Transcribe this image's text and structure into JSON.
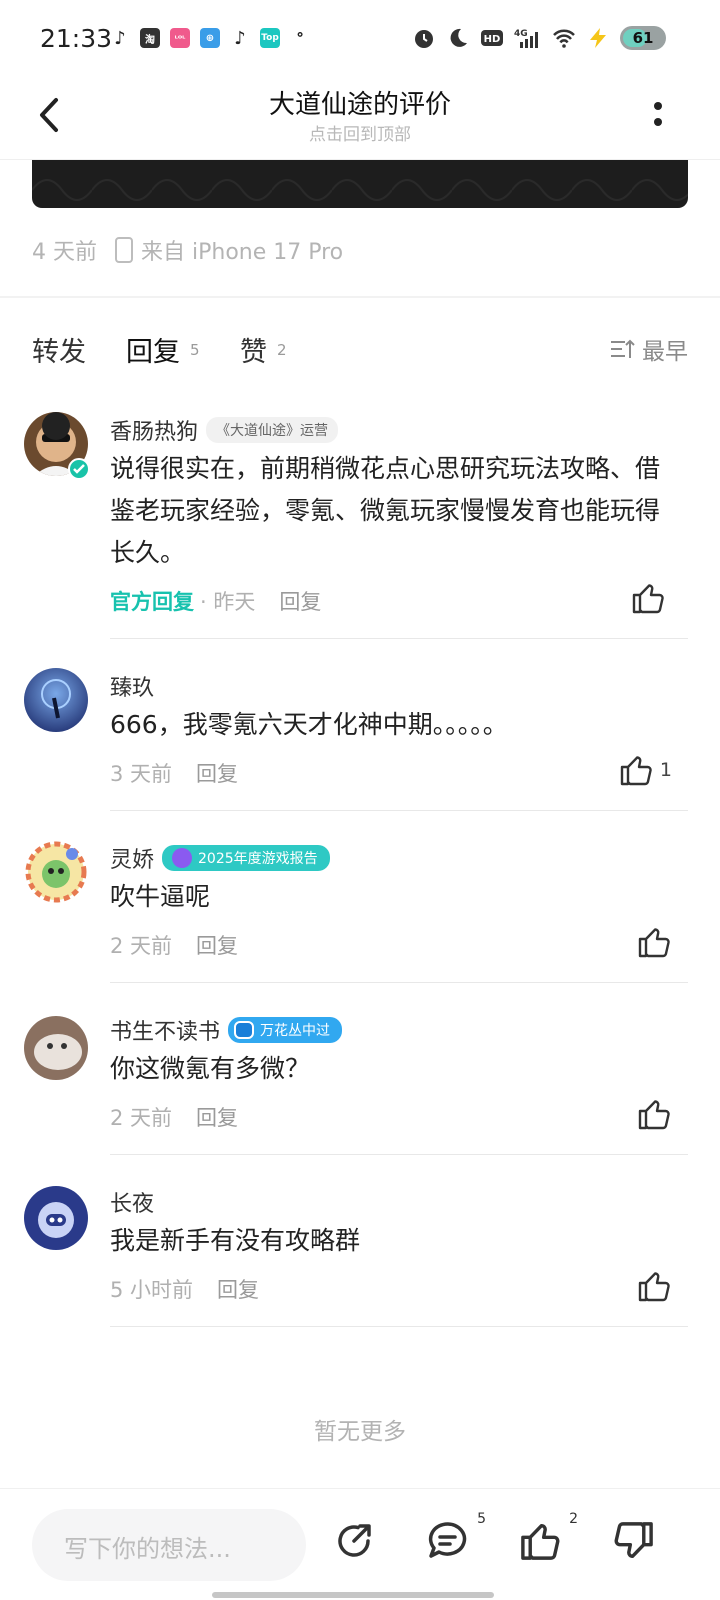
{
  "status_bar": {
    "time": "21:33",
    "battery": "61",
    "app_icons": [
      "tiktok-icon",
      "taobao-icon",
      "lolita-icon",
      "browser-icon",
      "tiktok-icon",
      "top-icon",
      "telecom-icon"
    ],
    "right_icons": [
      "alarm-icon",
      "moon-icon",
      "hd-icon",
      "4g-signal-icon",
      "wifi-icon",
      "charging-icon"
    ]
  },
  "header": {
    "title": "大道仙途的评价",
    "subtitle": "点击回到顶部"
  },
  "post_meta": {
    "time": "4 天前",
    "device": "来自 iPhone 17 Pro"
  },
  "tabs": {
    "forward": "转发",
    "reply": "回复",
    "reply_count": "5",
    "like": "赞",
    "like_count": "2",
    "sort": "最早"
  },
  "comments": [
    {
      "username": "香肠热狗",
      "badge": "《大道仙途》运营",
      "text": "说得很实在，前期稍微花点心思研究玩法攻略、借鉴老玩家经验，零氪、微氪玩家慢慢发育也能玩得长久。",
      "official_label": "官方回复",
      "time": "· 昨天",
      "reply": "回复",
      "likes": ""
    },
    {
      "username": "臻玖",
      "text": "666，我零氪六天才化神中期。。。。。",
      "time": "3 天前",
      "reply": "回复",
      "likes": "1"
    },
    {
      "username": "灵娇",
      "badge": "2025年度游戏报告",
      "text": "吹牛逼呢",
      "time": "2 天前",
      "reply": "回复",
      "likes": ""
    },
    {
      "username": "书生不读书",
      "badge": "万花丛中过",
      "text": "你这微氪有多微？",
      "time": "2 天前",
      "reply": "回复",
      "likes": ""
    },
    {
      "username": "长夜",
      "text": "我是新手有没有攻略群",
      "time": "5 小时前",
      "reply": "回复",
      "likes": ""
    }
  ],
  "no_more": "暂无更多",
  "bottom_bar": {
    "input_placeholder": "写下你的想法...",
    "comment_count": "5",
    "like_count": "2"
  },
  "colors": {
    "accent": "#17c2ae",
    "text": "#222222",
    "muted": "#b0b0b0"
  }
}
